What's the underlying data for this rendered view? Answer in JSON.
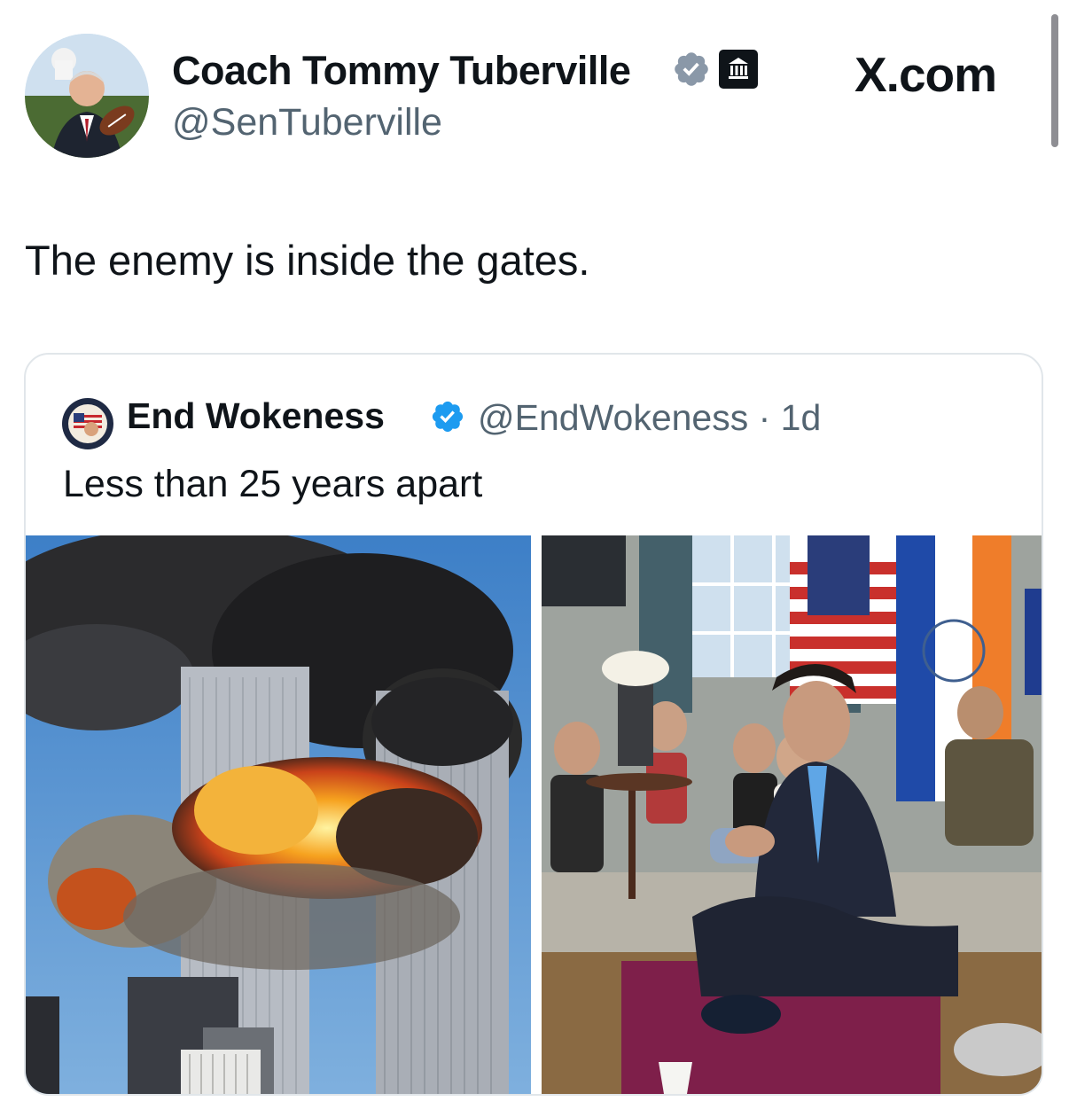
{
  "author": {
    "name": "Coach Tommy Tuberville",
    "handle": "@SenTuberville",
    "verified_icon": "verified-check-icon",
    "affiliation_icon": "government-building-icon"
  },
  "brand": "X.com",
  "tweet": {
    "text": "The enemy is inside the gates."
  },
  "quoted_tweet": {
    "author_name": "End Wokeness",
    "handle_time": "@EndWokeness · 1d",
    "text": "Less than 25 years apart",
    "verified_color": "#1d9bf0",
    "media": [
      {
        "name": "burning-towers-photo"
      },
      {
        "name": "gathering-room-photo"
      }
    ]
  },
  "colors": {
    "text": "#0f1419",
    "secondary": "#536471",
    "verified_main": "#8a98a8",
    "verified_quote": "#1d9bf0",
    "border": "#e1e6ea"
  }
}
